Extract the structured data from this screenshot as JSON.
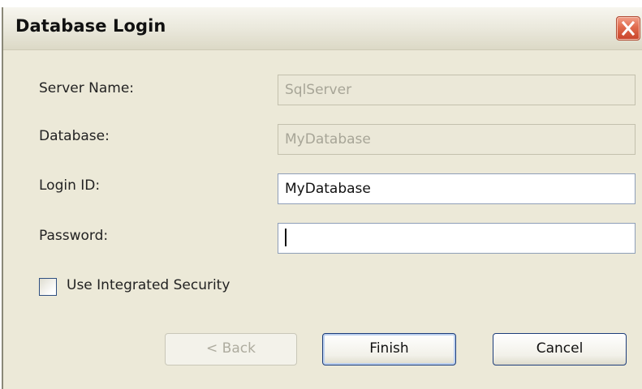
{
  "window": {
    "title": "Database Login",
    "close_icon": "close-icon",
    "colors": {
      "dialog_background": "#ece9d8",
      "close_button": "#e06a4c",
      "button_border": "#1d3d7a"
    }
  },
  "form": {
    "server_name": {
      "label": "Server Name:",
      "value": "SqlServer",
      "enabled": false
    },
    "database": {
      "label": "Database:",
      "value": "MyDatabase",
      "enabled": false
    },
    "login_id": {
      "label": "Login ID:",
      "value": "MyDatabase",
      "enabled": true
    },
    "password": {
      "label": "Password:",
      "value": "",
      "enabled": true,
      "focused": true
    },
    "integrated_security": {
      "label": "Use Integrated Security",
      "checked": false
    }
  },
  "buttons": {
    "back": {
      "label": "< Back",
      "enabled": false
    },
    "finish": {
      "label": "Finish",
      "enabled": true
    },
    "cancel": {
      "label": "Cancel",
      "enabled": true
    }
  }
}
